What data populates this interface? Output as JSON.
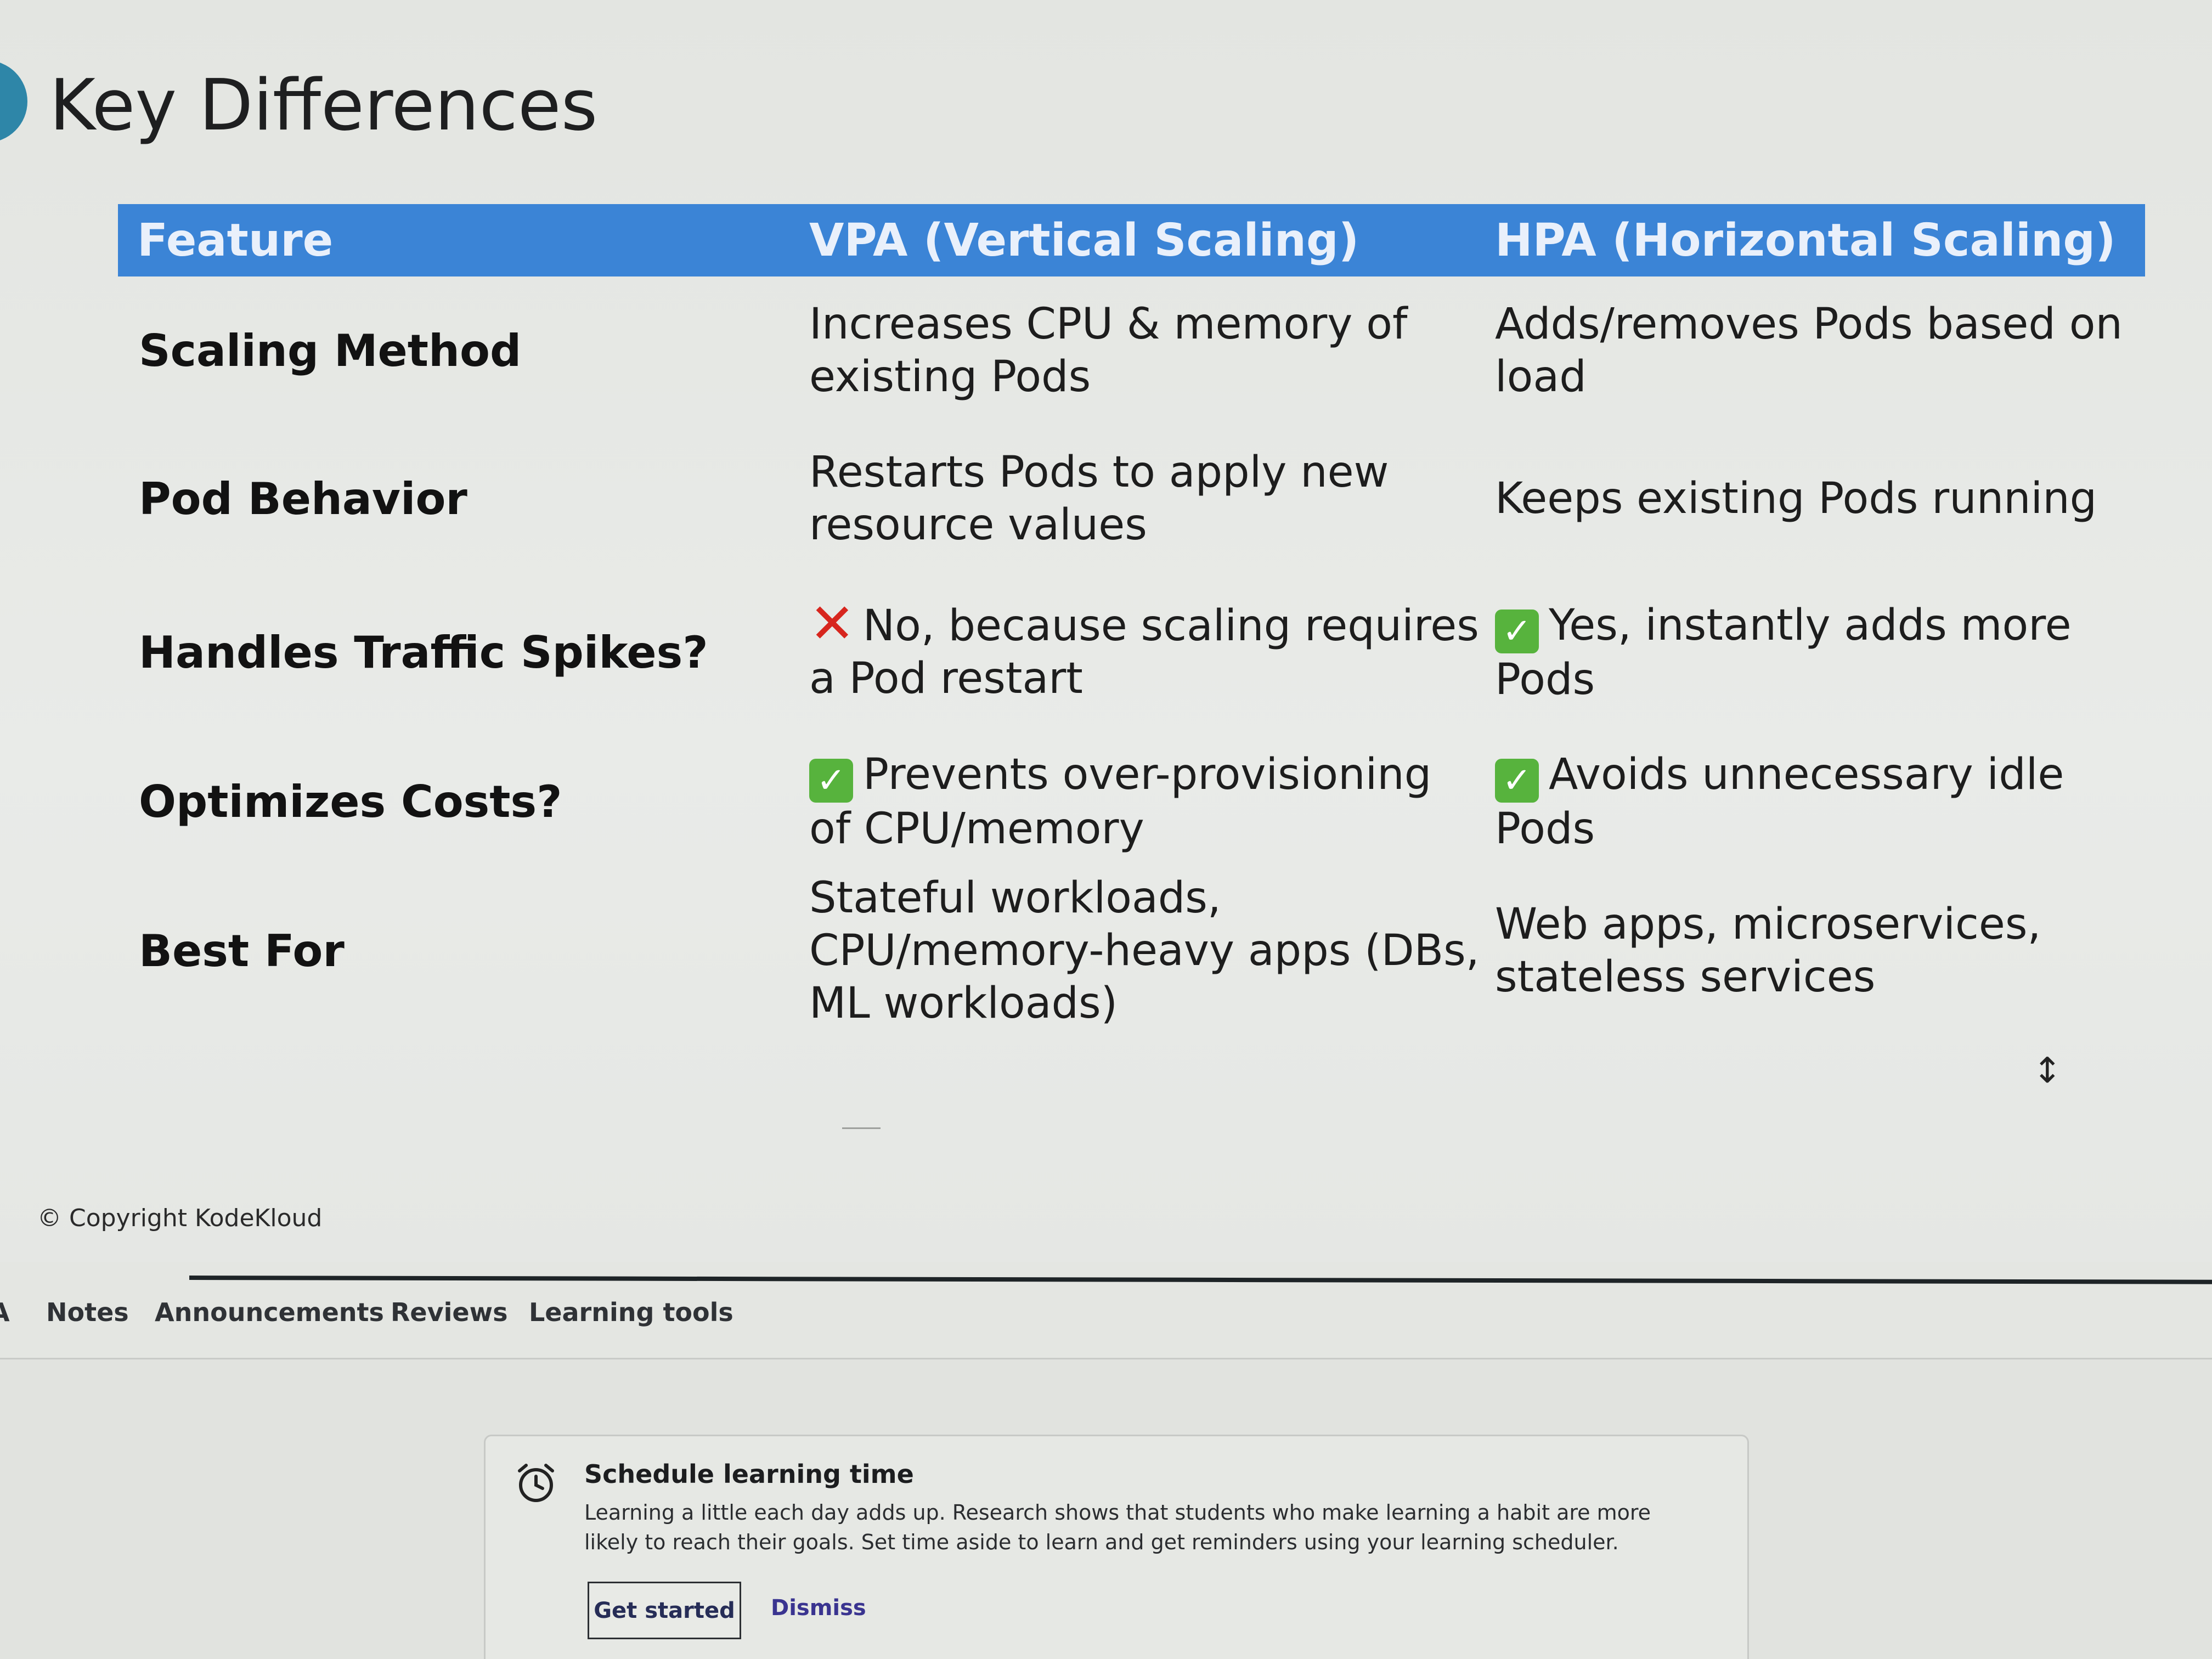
{
  "slide": {
    "title": "Key Differences",
    "headers": [
      "Feature",
      "VPA (Vertical Scaling)",
      "HPA (Horizontal Scaling)"
    ],
    "rows": [
      {
        "feature": "Scaling Method",
        "vpa": "Increases CPU & memory of existing Pods",
        "hpa": "Adds/removes Pods based on load"
      },
      {
        "feature": "Pod Behavior",
        "vpa": "Restarts Pods to apply new resource values",
        "hpa": "Keeps existing Pods running"
      },
      {
        "feature": "Handles Traffic Spikes?",
        "vpa_icon": "cross-mark-icon",
        "vpa": "No, because scaling requires a Pod restart",
        "hpa_icon": "check-mark-icon",
        "hpa": "Yes, instantly adds more Pods"
      },
      {
        "feature": "Optimizes Costs?",
        "vpa_icon": "check-mark-icon",
        "vpa": "Prevents over-provisioning of CPU/memory",
        "hpa_icon": "check-mark-icon",
        "hpa": "Avoids unnecessary idle Pods"
      },
      {
        "feature": "Best For",
        "vpa": "Stateful workloads, CPU/memory-heavy apps (DBs, ML workloads)",
        "hpa": "Web apps, microservices, stateless services"
      }
    ],
    "copyright": "© Copyright KodeKloud",
    "header_color": "#3b84d6"
  },
  "tabs": {
    "partial": "A",
    "items": [
      "Notes",
      "Announcements",
      "Reviews",
      "Learning tools"
    ]
  },
  "schedule_card": {
    "icon": "alarm-clock-icon",
    "title": "Schedule learning time",
    "text": "Learning a little each day adds up. Research shows that students who make learning a habit are more likely to reach their goals. Set time aside to learn and get reminders using your learning scheduler.",
    "primary_label": "Get started",
    "secondary_label": "Dismiss"
  }
}
